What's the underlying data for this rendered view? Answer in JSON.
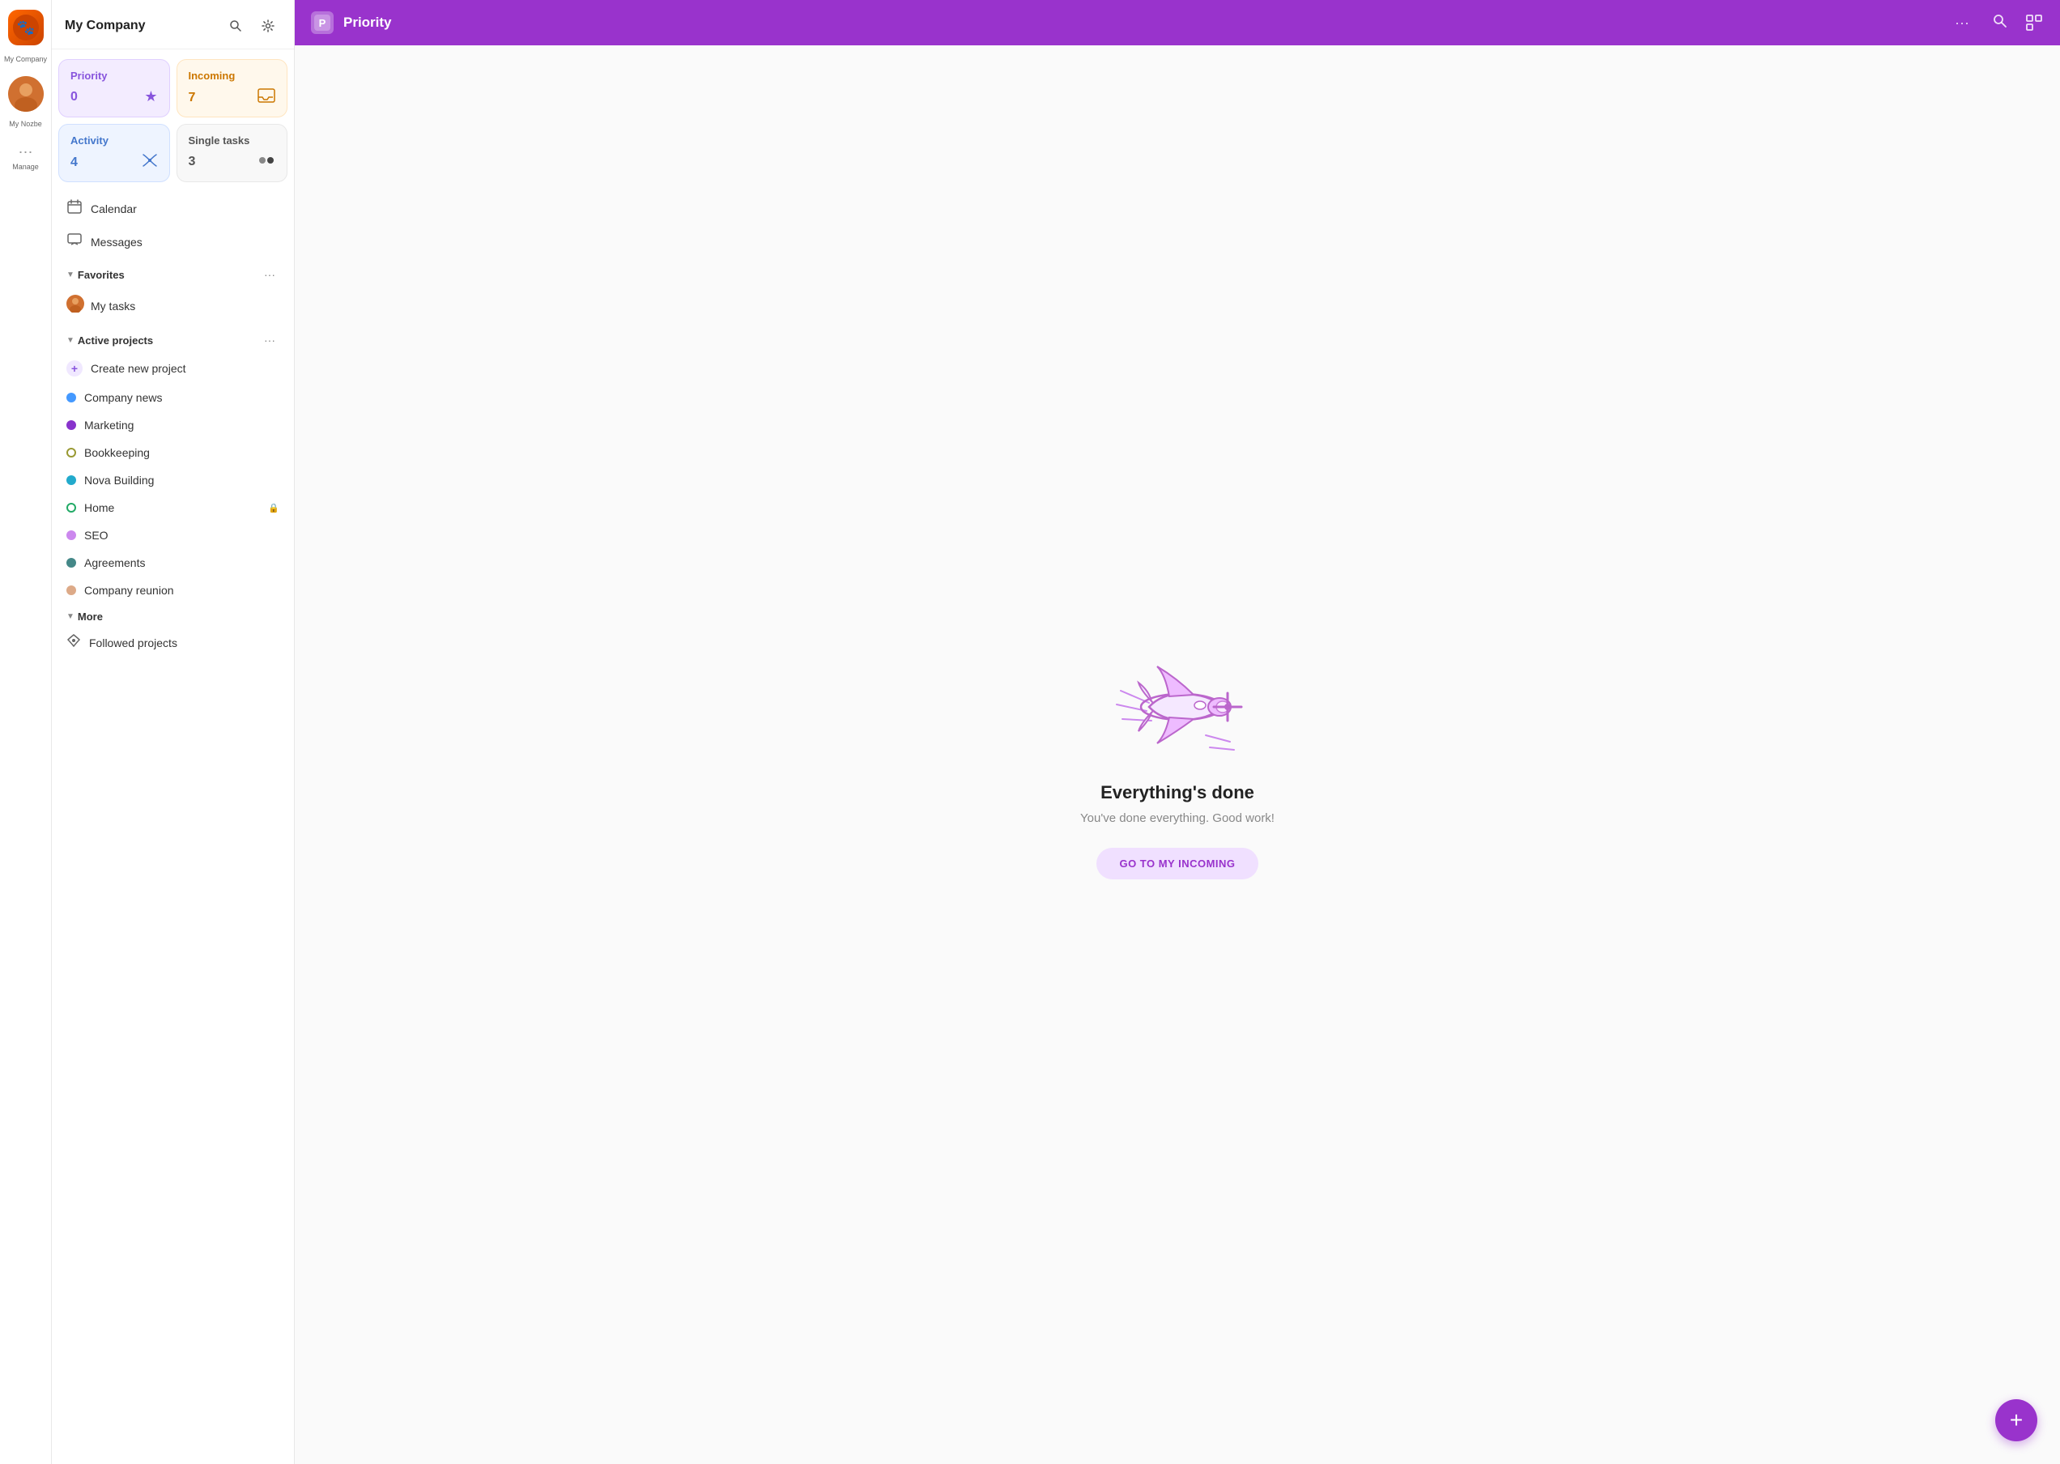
{
  "iconSidebar": {
    "companyName": "My Company",
    "nozbeLabel": "My Nozbe",
    "manageLabel": "Manage"
  },
  "sidebar": {
    "title": "My Company",
    "searchTooltip": "Search",
    "settingsTooltip": "Settings",
    "cards": [
      {
        "id": "priority",
        "label": "Priority",
        "count": "0",
        "iconUnicode": "★",
        "variant": "priority"
      },
      {
        "id": "incoming",
        "label": "Incoming",
        "count": "7",
        "iconUnicode": "📥",
        "variant": "incoming"
      },
      {
        "id": "activity",
        "label": "Activity",
        "count": "4",
        "iconUnicode": "📡",
        "variant": "activity"
      },
      {
        "id": "single-tasks",
        "label": "Single tasks",
        "count": "3",
        "iconUnicode": "⚫",
        "variant": "single"
      }
    ],
    "navItems": [
      {
        "id": "calendar",
        "label": "Calendar",
        "icon": "📅"
      },
      {
        "id": "messages",
        "label": "Messages",
        "icon": "💬"
      }
    ],
    "favorites": {
      "label": "Favorites",
      "items": [
        {
          "id": "my-tasks",
          "label": "My tasks",
          "hasAvatar": true
        }
      ]
    },
    "activeProjects": {
      "label": "Active projects",
      "items": [
        {
          "id": "create-new",
          "label": "Create new project",
          "type": "create"
        },
        {
          "id": "company-news",
          "label": "Company news",
          "dotColor": "#4499ff"
        },
        {
          "id": "marketing",
          "label": "Marketing",
          "dotColor": "#8833cc"
        },
        {
          "id": "bookkeeping",
          "label": "Bookkeeping",
          "dotColor": "#999933",
          "dotStyle": "ring"
        },
        {
          "id": "nova-building",
          "label": "Nova Building",
          "dotColor": "#22aacc"
        },
        {
          "id": "home",
          "label": "Home",
          "dotColor": "#22aa66",
          "dotStyle": "ring",
          "hasLock": true
        },
        {
          "id": "seo",
          "label": "SEO",
          "dotColor": "#cc88ee"
        },
        {
          "id": "agreements",
          "label": "Agreements",
          "dotColor": "#448888"
        },
        {
          "id": "company-reunion",
          "label": "Company reunion",
          "dotColor": "#ddaa88"
        }
      ]
    },
    "more": {
      "label": "More",
      "items": [
        {
          "id": "followed-projects",
          "label": "Followed projects",
          "icon": "📡"
        }
      ]
    }
  },
  "mainHeader": {
    "logoText": "P",
    "title": "Priority",
    "moreIcon": "···",
    "searchIcon": "🔍"
  },
  "emptyState": {
    "title": "Everything's done",
    "subtitle": "You've done everything. Good work!",
    "buttonLabel": "GO TO MY INCOMING"
  },
  "fab": {
    "label": "+"
  }
}
